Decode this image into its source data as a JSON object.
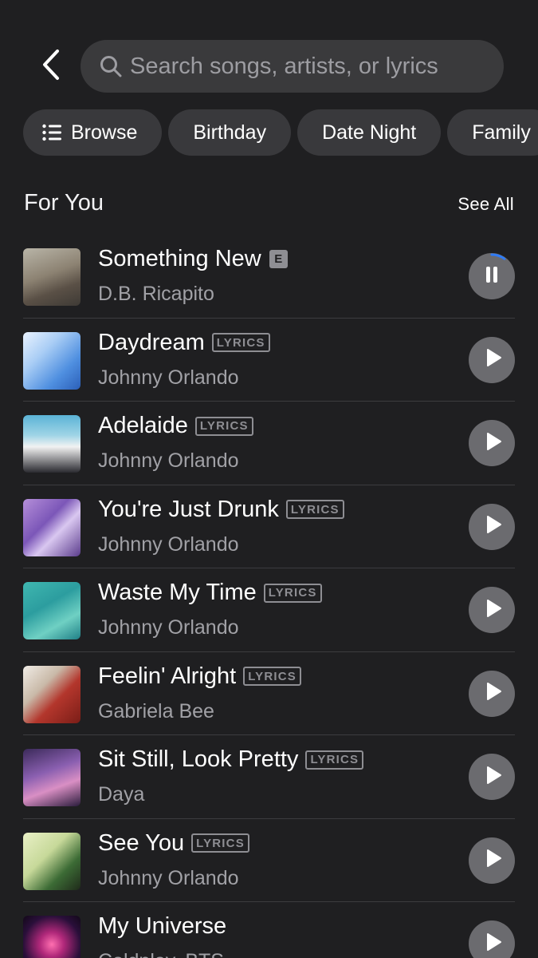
{
  "search": {
    "placeholder": "Search songs, artists, or lyrics"
  },
  "chips": [
    {
      "label": "Browse"
    },
    {
      "label": "Birthday"
    },
    {
      "label": "Date Night"
    },
    {
      "label": "Family"
    }
  ],
  "section": {
    "title": "For You",
    "see_all": "See All"
  },
  "songs": [
    {
      "title": "Something New",
      "badge": "E",
      "artist": "D.B. Ricapito",
      "state": "pause",
      "progress": 0.1
    },
    {
      "title": "Daydream",
      "badge": "LYRICS",
      "artist": "Johnny Orlando",
      "state": "play"
    },
    {
      "title": "Adelaide",
      "badge": "LYRICS",
      "artist": "Johnny Orlando",
      "state": "play"
    },
    {
      "title": "You're Just Drunk",
      "badge": "LYRICS",
      "artist": "Johnny Orlando",
      "state": "play"
    },
    {
      "title": "Waste My Time",
      "badge": "LYRICS",
      "artist": "Johnny Orlando",
      "state": "play"
    },
    {
      "title": "Feelin' Alright",
      "badge": "LYRICS",
      "artist": "Gabriela Bee",
      "state": "play"
    },
    {
      "title": "Sit Still, Look Pretty",
      "badge": "LYRICS",
      "artist": "Daya",
      "state": "play"
    },
    {
      "title": "See You",
      "badge": "LYRICS",
      "artist": "Johnny Orlando",
      "state": "play"
    },
    {
      "title": "My Universe",
      "badge": "",
      "artist": "Coldplay, BTS",
      "state": "play"
    }
  ],
  "colors": {
    "background": "#1f1f21",
    "accent_progress": "#2f7bf6",
    "badge_gray": "#8e8e93"
  }
}
